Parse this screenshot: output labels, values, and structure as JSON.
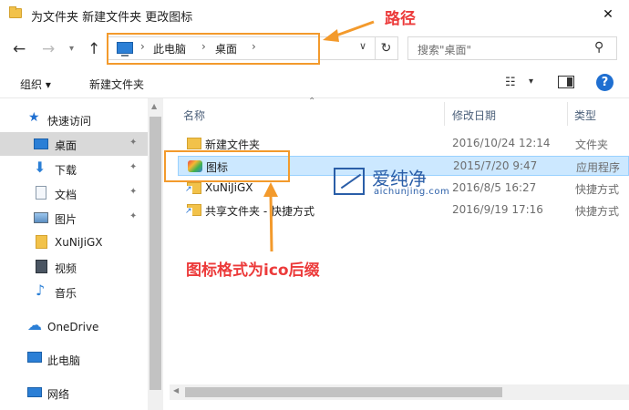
{
  "window": {
    "title": "为文件夹 新建文件夹 更改图标",
    "close_glyph": "✕"
  },
  "address": {
    "crumbs": [
      "此电脑",
      "桌面"
    ],
    "separator": "›",
    "search_placeholder": "搜索\"桌面\""
  },
  "toolbar": {
    "organize": "组织 ▾",
    "new_folder": "新建文件夹",
    "help": "?"
  },
  "sidebar": {
    "items": [
      {
        "label": "快速访问",
        "icon": "star-icon"
      },
      {
        "label": "桌面",
        "icon": "desktop-icon"
      },
      {
        "label": "下载",
        "icon": "download-icon"
      },
      {
        "label": "文档",
        "icon": "document-icon"
      },
      {
        "label": "图片",
        "icon": "picture-icon"
      },
      {
        "label": "XuNiJiGX",
        "icon": "folder-icon"
      },
      {
        "label": "视频",
        "icon": "video-icon"
      },
      {
        "label": "音乐",
        "icon": "music-icon"
      },
      {
        "label": "OneDrive",
        "icon": "cloud-icon"
      },
      {
        "label": "此电脑",
        "icon": "computer-icon"
      },
      {
        "label": "网络",
        "icon": "network-icon"
      }
    ]
  },
  "columns": {
    "name": "名称",
    "modified": "修改日期",
    "type": "类型"
  },
  "files": [
    {
      "name": "新建文件夹",
      "date": "2016/10/24 12:14",
      "type": "文件夹",
      "icon": "folder-icon"
    },
    {
      "name": "图标",
      "date": "2015/7/20 9:47",
      "type": "应用程序",
      "icon": "app-icon"
    },
    {
      "name": "XuNiJiGX",
      "date": "2016/8/5 16:27",
      "type": "快捷方式",
      "icon": "shortcut-icon"
    },
    {
      "name": "共享文件夹 - 快捷方式",
      "date": "2016/9/19 17:16",
      "type": "快捷方式",
      "icon": "shortcut-icon"
    }
  ],
  "annotations": {
    "path_label": "路径",
    "icon_format_label": "图标格式为ico后缀"
  },
  "watermark": {
    "title": "爱纯净",
    "subtitle": "aichunjing.com"
  },
  "colors": {
    "annotation_red": "#ec3a3a",
    "annotation_orange": "#f39a2c",
    "selection_blue": "#cce8ff",
    "accent_blue": "#1f6fd1"
  }
}
